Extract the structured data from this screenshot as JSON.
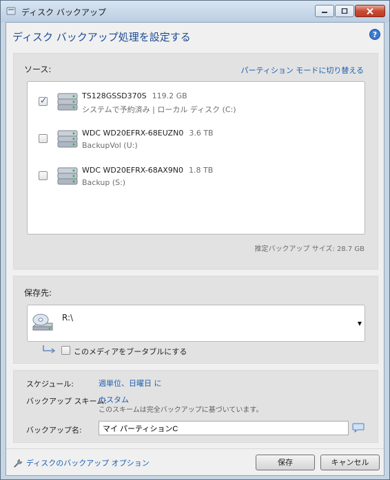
{
  "window": {
    "title": "ディスク バックアップ",
    "controls": {
      "minimize": "minimize",
      "maximize": "maximize",
      "close": "close"
    }
  },
  "header": {
    "title": "ディスク バックアップ処理を設定する",
    "help_icon": "help-icon"
  },
  "source": {
    "label": "ソース:",
    "switch_mode_link": "パーティション モードに切り替える",
    "disks": [
      {
        "name": "TS128GSSD370S",
        "size": "119.2 GB",
        "sub": "システムで予約済み | ローカル ディスク (C:)",
        "checked": true
      },
      {
        "name": "WDC WD20EFRX-68EUZN0",
        "size": "3.6 TB",
        "sub": "BackupVol (U:)",
        "checked": false
      },
      {
        "name": "WDC WD20EFRX-68AX9N0",
        "size": "1.8 TB",
        "sub": "Backup (S:)",
        "checked": false
      }
    ],
    "estimated_size": "推定バックアップ サイズ: 28.7 GB"
  },
  "destination": {
    "label": "保存先:",
    "path": "R:\\",
    "bootable_label": "このメディアをブータブルにする",
    "bootable_checked": false
  },
  "settings": {
    "schedule_label": "スケジュール:",
    "schedule_value": "週単位、日曜日 に",
    "scheme_label": "バックアップ スキーム:",
    "scheme_value": "カスタム",
    "scheme_desc": "このスキームは完全バックアップに基づいています。",
    "name_label": "バックアップ名:",
    "name_value": "マイ パーティションC"
  },
  "footer": {
    "options_link": "ディスクのバックアップ オプション",
    "save_button": "保存",
    "cancel_button": "キャンセル"
  },
  "colors": {
    "link": "#1b5fb0",
    "title": "#1c4b93",
    "close_button": "#c74b34"
  }
}
